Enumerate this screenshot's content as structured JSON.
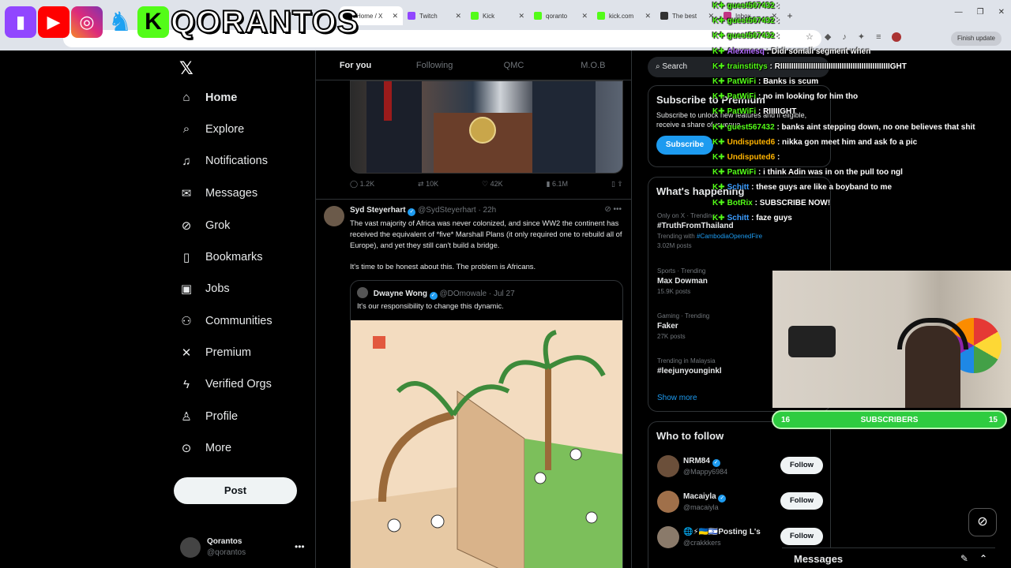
{
  "browser": {
    "tabs": [
      {
        "label": "Home / X",
        "color": "#000000",
        "active": true
      },
      {
        "label": "Twitch",
        "color": "#9146ff"
      },
      {
        "label": "Kick",
        "color": "#53fc18"
      },
      {
        "label": "qoranto",
        "color": "#53fc18"
      },
      {
        "label": "kick.com",
        "color": "#53fc18"
      },
      {
        "label": "The best",
        "color": "#333333"
      },
      {
        "label": "Inbox",
        "color": "#c13584"
      }
    ],
    "finish_update": "Finish update"
  },
  "banner": {
    "name": "QORANTOS"
  },
  "nav": {
    "items": [
      {
        "label": "Home",
        "icon": "home-icon",
        "glyph": "⌂"
      },
      {
        "label": "Explore",
        "icon": "search-icon",
        "glyph": "⌕"
      },
      {
        "label": "Notifications",
        "icon": "bell-icon",
        "glyph": "♫"
      },
      {
        "label": "Messages",
        "icon": "mail-icon",
        "glyph": "✉"
      },
      {
        "label": "Grok",
        "icon": "grok-icon",
        "glyph": "⊘"
      },
      {
        "label": "Bookmarks",
        "icon": "bookmark-icon",
        "glyph": "▯"
      },
      {
        "label": "Jobs",
        "icon": "briefcase-icon",
        "glyph": "▣"
      },
      {
        "label": "Communities",
        "icon": "communities-icon",
        "glyph": "⚇"
      },
      {
        "label": "Premium",
        "icon": "x-logo-icon",
        "glyph": "✕"
      },
      {
        "label": "Verified Orgs",
        "icon": "lightning-icon",
        "glyph": "ϟ"
      },
      {
        "label": "Profile",
        "icon": "person-icon",
        "glyph": "♙"
      },
      {
        "label": "More",
        "icon": "more-circle-icon",
        "glyph": "⊙"
      }
    ],
    "post": "Post",
    "me": {
      "name": "Qorantos",
      "handle": "@qorantos"
    }
  },
  "feed": {
    "tabs": [
      "For you",
      "Following",
      "QMC",
      "M.O.B"
    ],
    "prev_actions": {
      "replies": "1.2K",
      "reposts": "10K",
      "likes": "42K",
      "views": "6.1M"
    },
    "tweet": {
      "name": "Syd Steyerhart",
      "handle": "@SydSteyerhart",
      "time": "· 22h",
      "body": "The vast majority of Africa was never colonized, and since WW2 the continent has received the equivalent of *five* Marshall Plans (it only required one to rebuild all of Europe), and yet they still can't build a bridge.",
      "body2": "It's time to be honest about this. The problem is Africans.",
      "quote": {
        "name": "Dwayne Wong",
        "handle": "@DOmowale",
        "time": "· Jul 27",
        "text": "It's our responsibility to change this dynamic."
      }
    }
  },
  "right": {
    "search": "Search",
    "premium": {
      "title": "Subscribe to Premium",
      "text": "Subscribe to unlock new features and if eligible, receive a share of revenue.",
      "button": "Subscribe"
    },
    "happening": {
      "title": "What's happening",
      "trends": [
        {
          "meta": "Only on X · Trending",
          "name": "#TruthFromThailand",
          "sub": "Trending with",
          "link": "#CambodiaOpenedFire",
          "count": "3.02M posts"
        },
        {
          "meta": "Sports · Trending",
          "name": "Max Dowman",
          "count": "15.9K posts"
        },
        {
          "meta": "Gaming · Trending",
          "name": "Faker",
          "count": "27K posts"
        },
        {
          "meta": "Trending in Malaysia",
          "name": "#leejunyounginkl",
          "count": ""
        }
      ],
      "show_more": "Show more"
    },
    "who": {
      "title": "Who to follow",
      "accounts": [
        {
          "name": "NRM84",
          "handle": "@Mappy6984",
          "follow": "Follow"
        },
        {
          "name": "Macaiyla",
          "handle": "@macaiyla",
          "follow": "Follow"
        },
        {
          "name": "🌐⚡🇺🇦🇮🇱Posting L's",
          "handle": "@crakkkers",
          "follow": "Follow"
        }
      ]
    }
  },
  "chat": [
    {
      "user": "guest567432",
      "color": "#53fc18",
      "msg": ":"
    },
    {
      "user": "guest567432",
      "color": "#53fc18",
      "msg": ":"
    },
    {
      "user": "guest567432",
      "color": "#53fc18",
      "msg": ":"
    },
    {
      "user": "Alexmesq",
      "color": "#b36bff",
      "msg": ": Didi somali segment when"
    },
    {
      "user": "trainstittys",
      "color": "#53fc18",
      "msg": ": RIIIIIIIIIIIIIIIIIIIIIIIIIIIIIIIIIIIIIIIIIIIIIIIIIIGHT"
    },
    {
      "user": "PatWiFi",
      "color": "#53fc18",
      "msg": ": Banks is scum"
    },
    {
      "user": "PatWiFi",
      "color": "#53fc18",
      "msg": ": no im looking for him tho"
    },
    {
      "user": "PatWiFi",
      "color": "#53fc18",
      "msg": ": RIIIIIGHT"
    },
    {
      "user": "guest567432",
      "color": "#53fc18",
      "msg": ": banks aint stepping down, no one believes that shit"
    },
    {
      "user": "Undisputed6",
      "color": "#ffb300",
      "msg": ": nikka gon meet him and ask fo a pic"
    },
    {
      "user": "Undisputed6",
      "color": "#ffb300",
      "msg": ":"
    },
    {
      "user": "PatWiFi",
      "color": "#53fc18",
      "msg": ": i think Adin was in on the pull too ngl"
    },
    {
      "user": "Schitt",
      "color": "#3b9cff",
      "msg": ": these guys are like a boyband to me"
    },
    {
      "user": "BotRix",
      "color": "#53fc18",
      "msg": ": SUBSCRIBE NOW!"
    },
    {
      "user": "Schitt",
      "color": "#3b9cff",
      "msg": ": faze guys"
    }
  ],
  "subs": {
    "left": "16",
    "label": "SUBSCRIBERS",
    "right": "15"
  },
  "messages": {
    "title": "Messages"
  }
}
